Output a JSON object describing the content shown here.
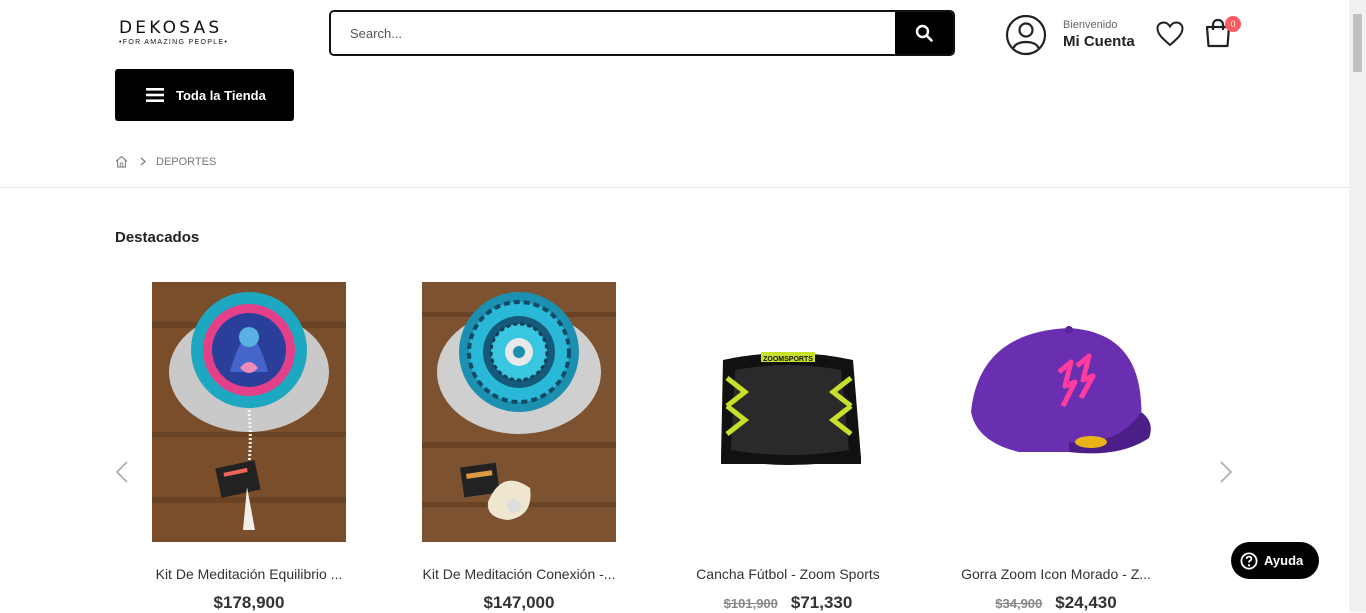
{
  "header": {
    "logo_main": "DEKOSAS",
    "logo_sub": "•FOR AMAZING PEOPLE•",
    "search": {
      "placeholder": "Search..."
    },
    "account": {
      "welcome": "Bienvenido",
      "name": "Mi Cuenta"
    },
    "cart_count": "0",
    "category_button": "Toda la Tienda"
  },
  "breadcrumb": {
    "current": "DEPORTES"
  },
  "section": {
    "title": "Destacados"
  },
  "products": [
    {
      "name": "Kit De Meditación Equilibrio ...",
      "price": "$178,900",
      "old_price": ""
    },
    {
      "name": "Kit De Meditación Conexión -...",
      "price": "$147,000",
      "old_price": ""
    },
    {
      "name": "Cancha Fútbol - Zoom Sports",
      "price": "$71,330",
      "old_price": "$101,900"
    },
    {
      "name": "Gorra Zoom Icon Morado - Z...",
      "price": "$24,430",
      "old_price": "$34,900"
    }
  ],
  "help": {
    "label": "Ayuda"
  },
  "icons": [
    "search-icon",
    "account-icon",
    "heart-icon",
    "cart-icon",
    "menu-icon",
    "home-icon",
    "chevron-right-icon",
    "chevron-left-icon",
    "help-icon"
  ],
  "colors": {
    "accent": "#000000",
    "badge": "#ff5a5f"
  }
}
